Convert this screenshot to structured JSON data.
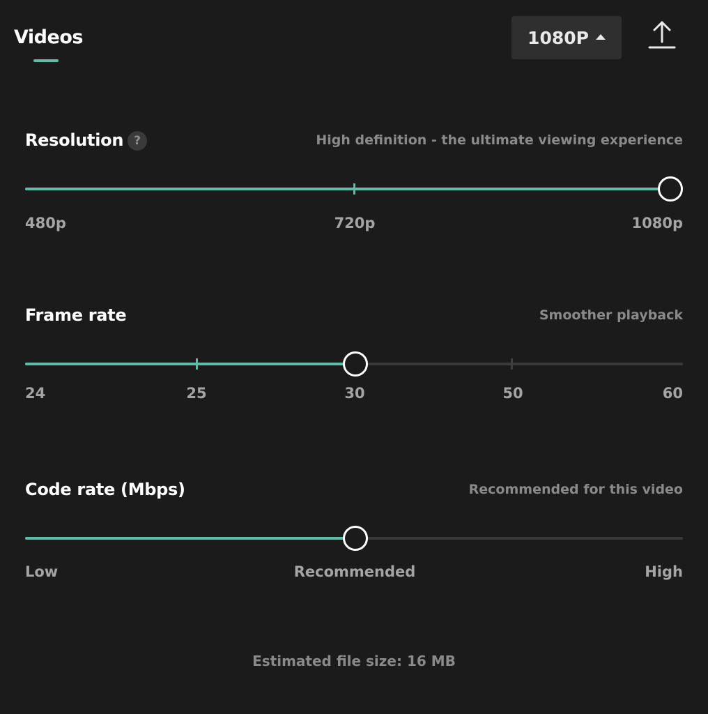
{
  "header": {
    "tab_label": "Videos",
    "resolution_button": "1080P",
    "export_icon": "upload-icon"
  },
  "sections": {
    "resolution": {
      "title": "Resolution",
      "help_icon": "question-icon",
      "help_glyph": "?",
      "description": "High definition - the ultimate viewing experience",
      "ticks": [
        "480p",
        "720p",
        "1080p"
      ],
      "selected": "1080p"
    },
    "frame_rate": {
      "title": "Frame rate",
      "description": "Smoother playback",
      "ticks": [
        "24",
        "25",
        "30",
        "50",
        "60"
      ],
      "selected": "30"
    },
    "code_rate": {
      "title": "Code rate (Mbps)",
      "description": "Recommended for this video",
      "labels": [
        "Low",
        "Recommended",
        "High"
      ],
      "value_fraction": 0.5
    }
  },
  "footer": {
    "estimated_size": "Estimated file size: 16 MB"
  },
  "colors": {
    "accent": "#5bbfa8",
    "background": "#1b1b1b",
    "track": "#3a3a3a"
  }
}
